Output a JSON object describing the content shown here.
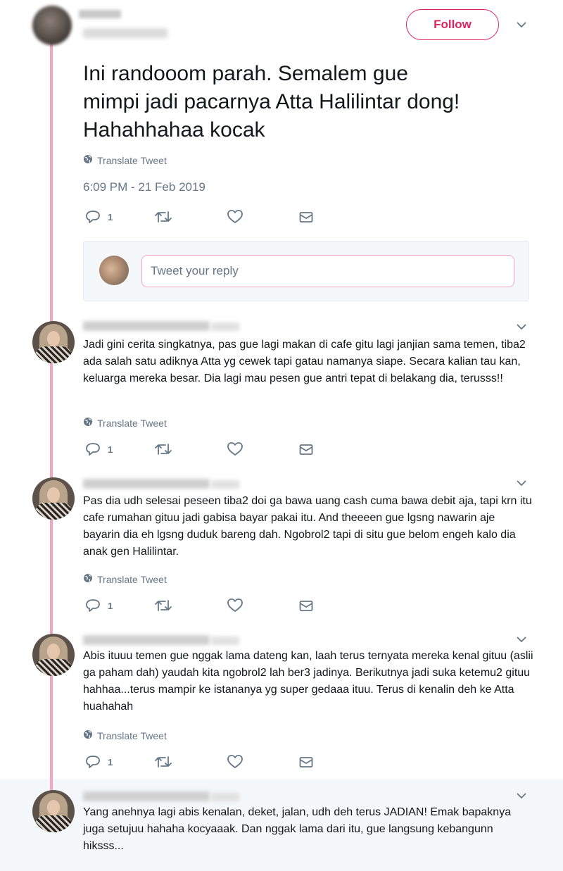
{
  "header": {
    "follow_label": "Follow"
  },
  "main_tweet": {
    "text": "Ini randooom parah. Semalem gue\nmimpi jadi pacarnya Atta Halilintar dong!\nHahahhahaa kocak",
    "translate_label": "Translate Tweet",
    "timestamp": "6:09 PM - 21 Feb 2019",
    "reply_count": "1"
  },
  "reply_box": {
    "placeholder": "Tweet your reply"
  },
  "replies": [
    {
      "text": "Jadi gini cerita singkatnya, pas gue lagi makan di cafe gitu lagi janjian sama temen, tiba2 ada salah satu adiknya Atta yg cewek tapi gatau namanya siape. Secara kalian tau kan, keluarga mereka besar. Dia lagi mau pesen gue antri tepat di belakang dia, terusss!!",
      "translate_label": "Translate Tweet",
      "reply_count": "1"
    },
    {
      "text": "Pas dia udh selesai peseen tiba2 doi ga bawa uang cash cuma bawa debit aja, tapi krn itu cafe rumahan gituu jadi gabisa bayar pakai itu. And theeeen gue lgsng nawarin aje bayarin dia eh lgsng duduk bareng dah. Ngobrol2 tapi di situ gue belom engeh kalo dia anak gen Halilintar.",
      "translate_label": "Translate Tweet",
      "reply_count": "1"
    },
    {
      "text": "Abis ituuu temen gue nggak lama dateng kan, laah terus ternyata mereka kenal gituu (aslii ga paham dah) yaudah kita ngobrol2 lah ber3 jadinya. Berikutnya jadi suka ketemu2 gituu hahhaa...terus mampir ke istananya yg super gedaaa ituu. Terus di kenalin deh ke Atta huahahah",
      "translate_label": "Translate Tweet",
      "reply_count": "1"
    },
    {
      "text": "Yang anehnya lagi abis kenalan, deket, jalan, udh deh terus JADIAN! Emak bapaknya juga setujuu hahaha kocyaaak. Dan nggak lama dari itu, gue langsung kebangunn hiksss..."
    }
  ],
  "colors": {
    "accent": "#e0245e",
    "thread_line": "#f4a6bf",
    "muted": "#657786"
  },
  "icons": [
    "globe-icon",
    "reply-icon",
    "retweet-icon",
    "like-icon",
    "message-icon",
    "chevron-down-icon"
  ]
}
